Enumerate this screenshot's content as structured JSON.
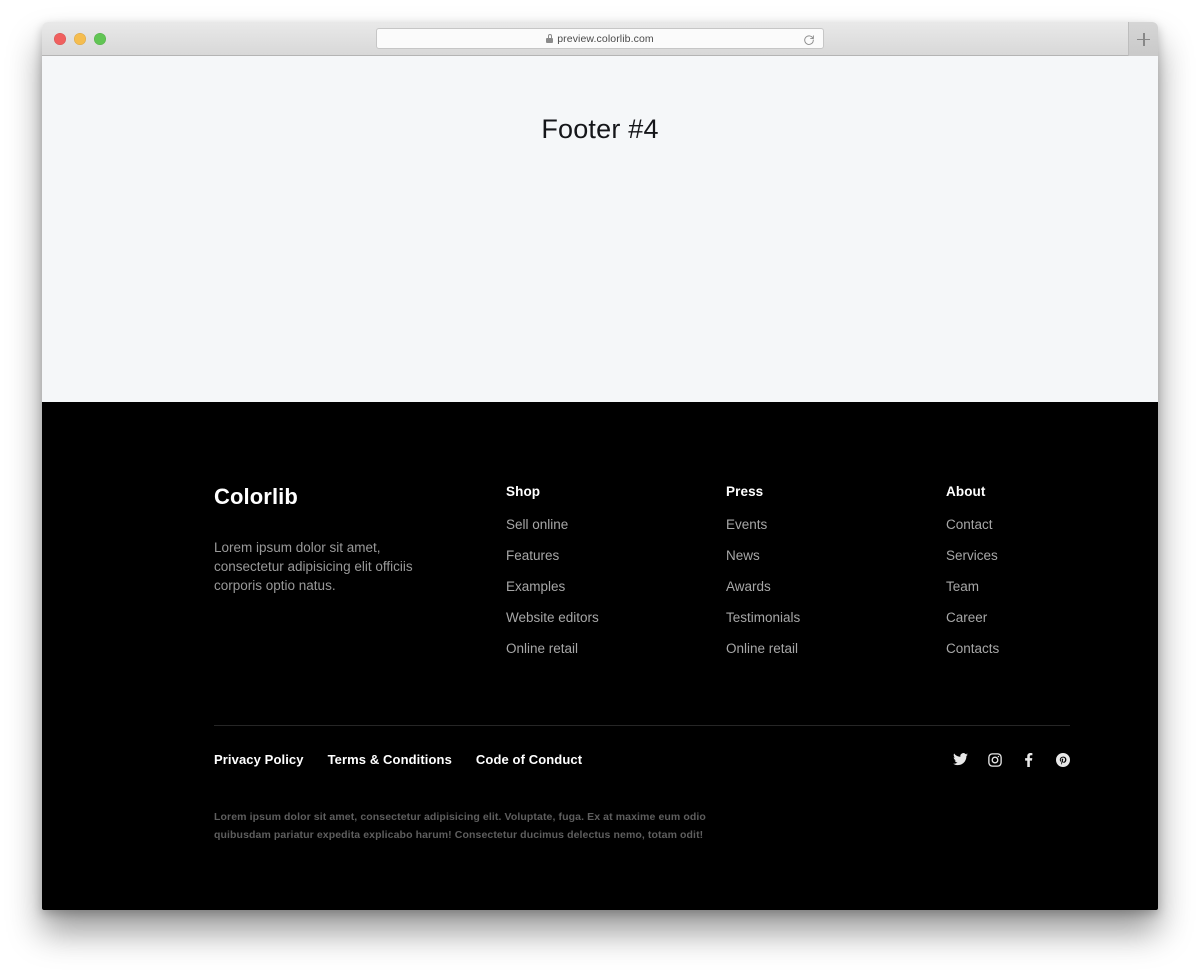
{
  "browser": {
    "url": "preview.colorlib.com",
    "lock_icon": "lock-icon",
    "reload_icon": "reload-icon",
    "new_tab_icon": "plus-icon",
    "traffic_lights": [
      "close",
      "minimize",
      "maximize"
    ]
  },
  "page": {
    "hero_title": "Footer #4",
    "background_color": "#f5f7f9"
  },
  "footer": {
    "background_color": "#000000",
    "brand": {
      "name": "Colorlib",
      "description": "Lorem ipsum dolor sit amet, consectetur adipisicing elit officiis corporis optio natus."
    },
    "columns": [
      {
        "title": "Shop",
        "links": [
          "Sell online",
          "Features",
          "Examples",
          "Website editors",
          "Online retail"
        ]
      },
      {
        "title": "Press",
        "links": [
          "Events",
          "News",
          "Awards",
          "Testimonials",
          "Online retail"
        ]
      },
      {
        "title": "About",
        "links": [
          "Contact",
          "Services",
          "Team",
          "Career",
          "Contacts"
        ]
      }
    ],
    "legal_links": [
      "Privacy Policy",
      "Terms & Conditions",
      "Code of Conduct"
    ],
    "social": [
      {
        "name": "twitter",
        "icon": "twitter-icon"
      },
      {
        "name": "instagram",
        "icon": "instagram-icon"
      },
      {
        "name": "facebook",
        "icon": "facebook-icon"
      },
      {
        "name": "pinterest",
        "icon": "pinterest-icon"
      }
    ],
    "fine_print": "Lorem ipsum dolor sit amet, consectetur adipisicing elit. Voluptate, fuga. Ex at maxime eum odio quibusdam pariatur expedita explicabo harum! Consectetur ducimus delectus nemo, totam odit!"
  }
}
